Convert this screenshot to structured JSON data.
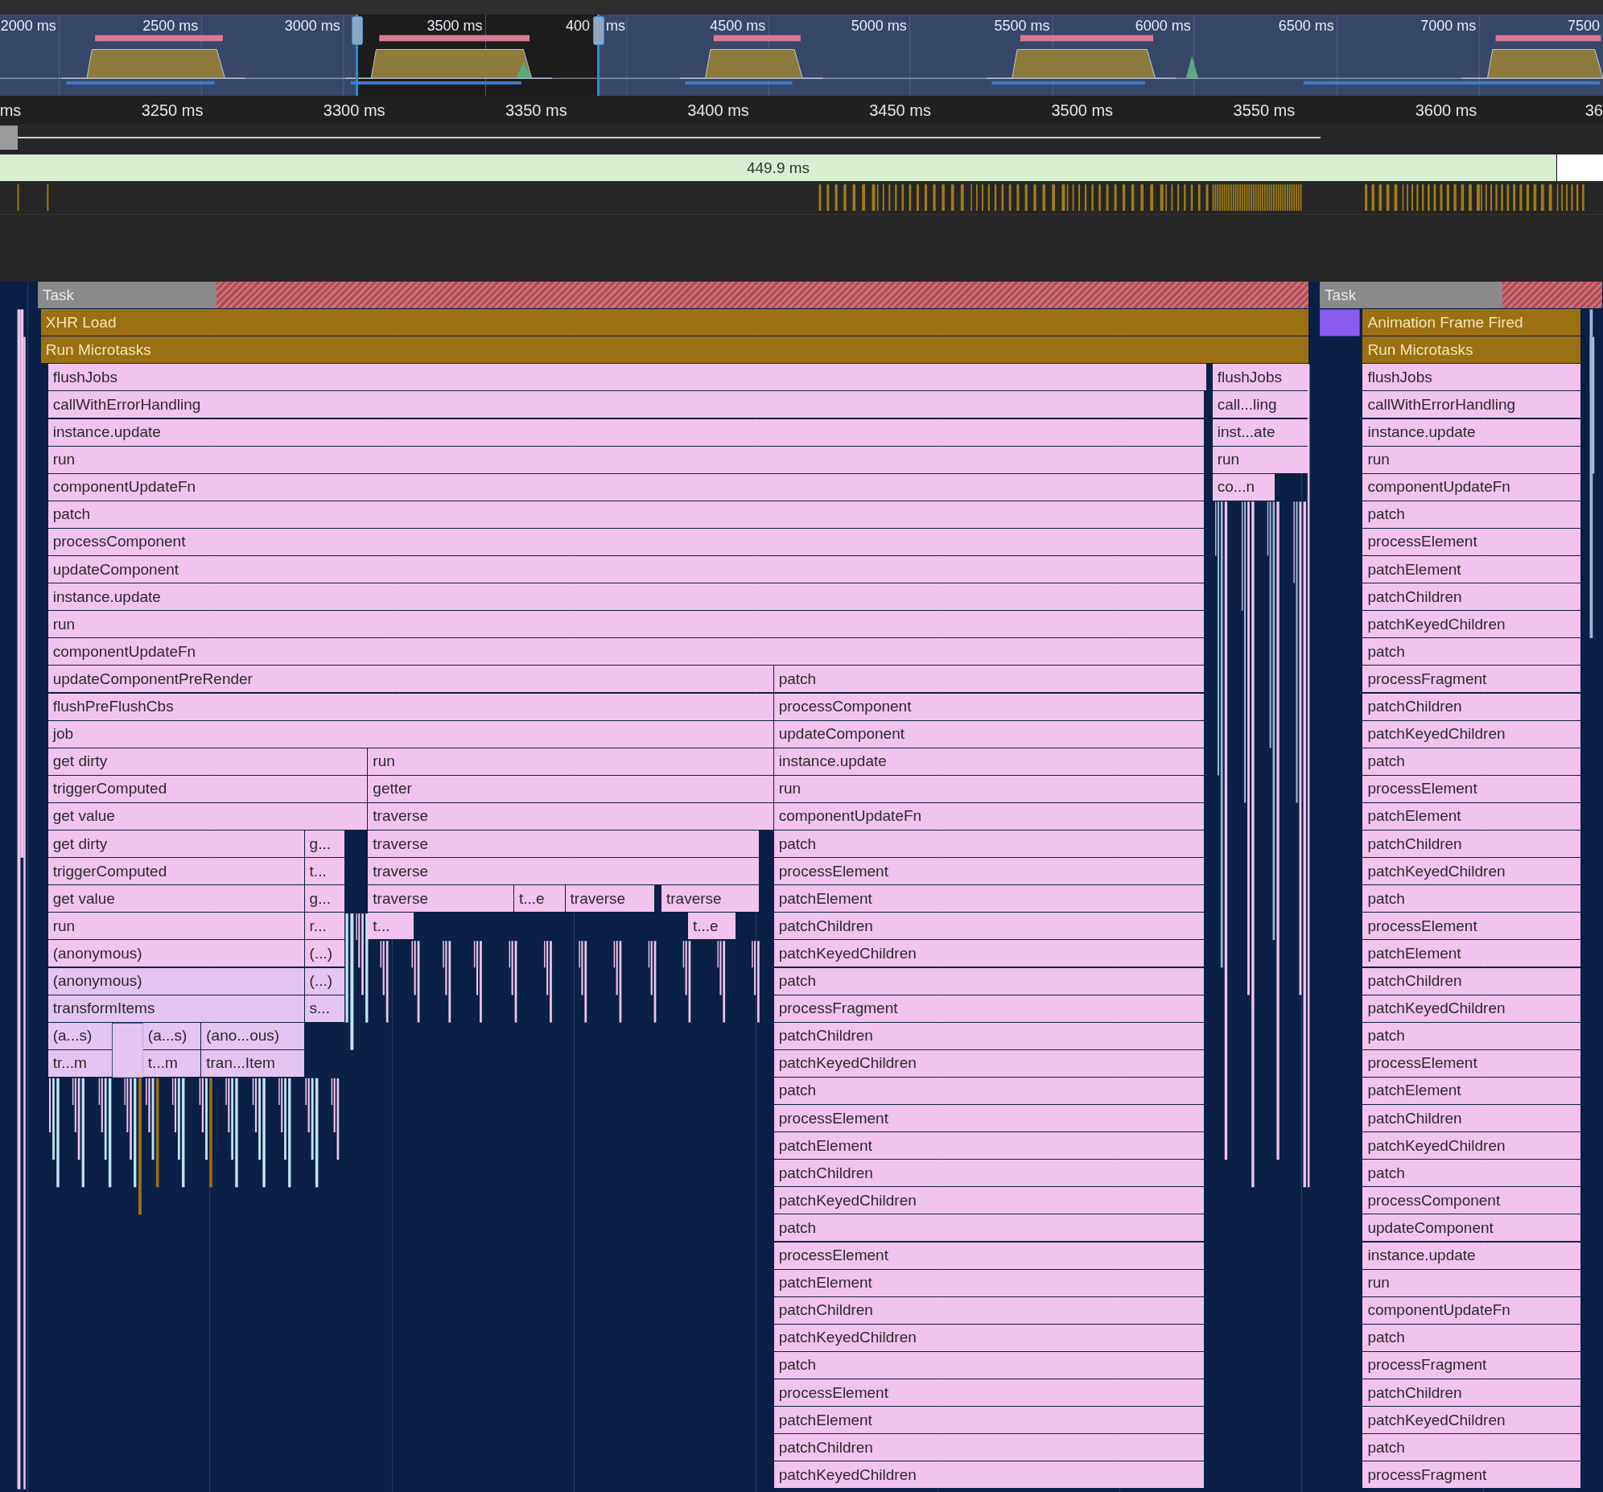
{
  "overview": {
    "ticks": [
      {
        "text": "2000 ms"
      },
      {
        "text": "2500 ms"
      },
      {
        "text": "3000 ms"
      },
      {
        "text": "3500 ms"
      },
      {
        "text": "400",
        "tail": "ms"
      },
      {
        "text": "4500 ms"
      },
      {
        "text": "5000 ms"
      },
      {
        "text": "5500 ms"
      },
      {
        "text": "6000 ms"
      },
      {
        "text": "6500 ms"
      },
      {
        "text": "7000 ms"
      },
      {
        "text": "7500"
      }
    ]
  },
  "ruler": {
    "ticks": [
      "ms",
      "3250 ms",
      "3300 ms",
      "3350 ms",
      "3400 ms",
      "3450 ms",
      "3500 ms",
      "3550 ms",
      "3600 ms",
      "36"
    ]
  },
  "selection_bar": {
    "duration": "449.9 ms"
  },
  "flame_chart": {
    "stacks": [
      {
        "kind": "task",
        "frames": [
          "Task"
        ]
      },
      {
        "kind": "task",
        "frames": [
          "Task"
        ]
      },
      {
        "kind": "event",
        "frames": [
          "XHR Load",
          "Run Microtasks"
        ]
      },
      {
        "kind": "js",
        "frames": [
          "flushJobs"
        ]
      },
      {
        "kind": "js",
        "frames": [
          "callWithErrorHandling",
          "instance.update",
          "run",
          "componentUpdateFn",
          "patch",
          "processComponent",
          "updateComponent",
          "instance.update",
          "run",
          "componentUpdateFn"
        ]
      },
      {
        "kind": "js",
        "frames": [
          "updateComponentPreRender",
          "flushPreFlushCbs",
          "job"
        ]
      },
      {
        "kind": "js",
        "frames": [
          "get dirty",
          "triggerComputed",
          "get value"
        ]
      },
      {
        "kind": "js",
        "frames": [
          "get dirty",
          "triggerComputed",
          "get value",
          "run",
          "(anonymous)"
        ]
      },
      {
        "kind": "alt",
        "frames": [
          "(anonymous)",
          "transformItems"
        ]
      },
      {
        "kind": "alt",
        "frames": [
          "(a...s)",
          "tr...m"
        ]
      },
      {
        "kind": "alt",
        "frames": [
          "(a...s)",
          "t...m"
        ]
      },
      {
        "kind": "alt",
        "frames": [
          "(ano...ous)",
          "tran...Item"
        ]
      },
      {
        "kind": "js",
        "frames": [
          "g...",
          "t...",
          "g...",
          "r...",
          "(...)"
        ]
      },
      {
        "kind": "alt",
        "frames": [
          "(...)",
          "s..."
        ]
      },
      {
        "kind": "js",
        "frames": [
          "run",
          "getter",
          "traverse"
        ]
      },
      {
        "kind": "js",
        "frames": [
          "traverse",
          "traverse"
        ]
      },
      {
        "kind": "js",
        "frames": [
          "traverse"
        ]
      },
      {
        "kind": "js",
        "frames": [
          "t...e"
        ]
      },
      {
        "kind": "js",
        "frames": [
          "traverse"
        ]
      },
      {
        "kind": "js",
        "frames": [
          "traverse"
        ]
      },
      {
        "kind": "js",
        "frames": [
          "t..."
        ]
      },
      {
        "kind": "js",
        "frames": [
          "t...e"
        ]
      },
      {
        "kind": "js",
        "frames": [
          "patch",
          "processComponent",
          "updateComponent",
          "instance.update",
          "run",
          "componentUpdateFn",
          "patch",
          "processElement",
          "patchElement",
          "patchChildren",
          "patchKeyedChildren",
          "patch",
          "processFragment",
          "patchChildren",
          "patchKeyedChildren",
          "patch",
          "processElement",
          "patchElement",
          "patchChildren",
          "patchKeyedChildren",
          "patch",
          "processElement",
          "patchElement",
          "patchChildren",
          "patchKeyedChildren",
          "patch",
          "processElement",
          "patchElement",
          "patchChildren",
          "patchKeyedChildren"
        ]
      },
      {
        "kind": "js",
        "frames": [
          "flushJobs",
          "call...ling",
          "inst...ate",
          "run"
        ]
      },
      {
        "kind": "js",
        "frames": [
          "co...n"
        ]
      },
      {
        "kind": "event",
        "frames": [
          "Animation Frame Fired",
          "Run Microtasks"
        ]
      },
      {
        "kind": "js",
        "frames": [
          "flushJobs",
          "callWithErrorHandling",
          "instance.update",
          "run",
          "componentUpdateFn",
          "patch",
          "processElement",
          "patchElement",
          "patchChildren",
          "patchKeyedChildren",
          "patch",
          "processFragment",
          "patchChildren",
          "patchKeyedChildren",
          "patch",
          "processElement",
          "patchElement",
          "patchChildren",
          "patchKeyedChildren",
          "patch",
          "processElement",
          "patchElement",
          "patchChildren",
          "patchKeyedChildren",
          "patch",
          "processElement",
          "patchElement",
          "patchChildren",
          "patchKeyedChildren",
          "patch",
          "processComponent",
          "updateComponent",
          "instance.update",
          "run",
          "componentUpdateFn",
          "patch",
          "processFragment",
          "patchChildren",
          "patchKeyedChildren",
          "patch",
          "processFragment"
        ]
      }
    ]
  }
}
